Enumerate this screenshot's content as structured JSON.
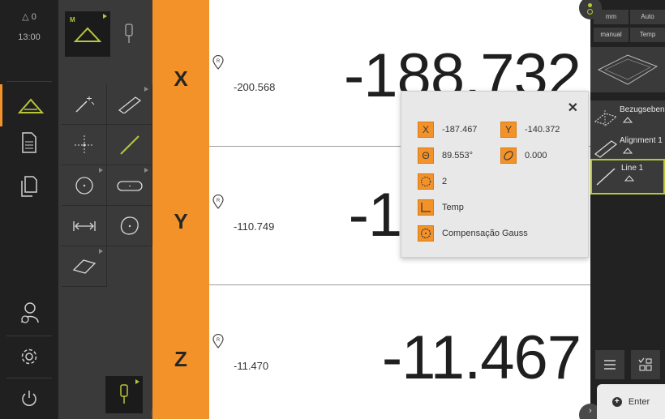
{
  "left_rail": {
    "counter": "△ 0",
    "time": "13:00"
  },
  "axes": [
    {
      "letter": "X",
      "reference_value": "-200.568",
      "value": "-188.732"
    },
    {
      "letter": "Y",
      "reference_value": "-110.749",
      "value": "-110.749"
    },
    {
      "letter": "Z",
      "reference_value": "-11.470",
      "value": "-11.467"
    }
  ],
  "popup": {
    "x_label": "X",
    "x_value": "-187.467",
    "y_label": "Y",
    "y_value": "-140.372",
    "angle_value": "89.553°",
    "form_value": "0.000",
    "points_value": "2",
    "coordinate_system": "Temp",
    "filter": "Compensação Gauss"
  },
  "right_panel": {
    "unit_mm": "mm",
    "mode_auto": "Auto",
    "mode_manual": "manual",
    "mode_temp": "Temp",
    "features": [
      {
        "label": "Bezugsebene"
      },
      {
        "label": "Alignment 1"
      },
      {
        "label": "Line 1"
      }
    ],
    "enter_label": "Enter"
  },
  "colors": {
    "accent_orange": "#f39229",
    "active_green": "#b8c53a",
    "dark_bg": "#202020"
  }
}
